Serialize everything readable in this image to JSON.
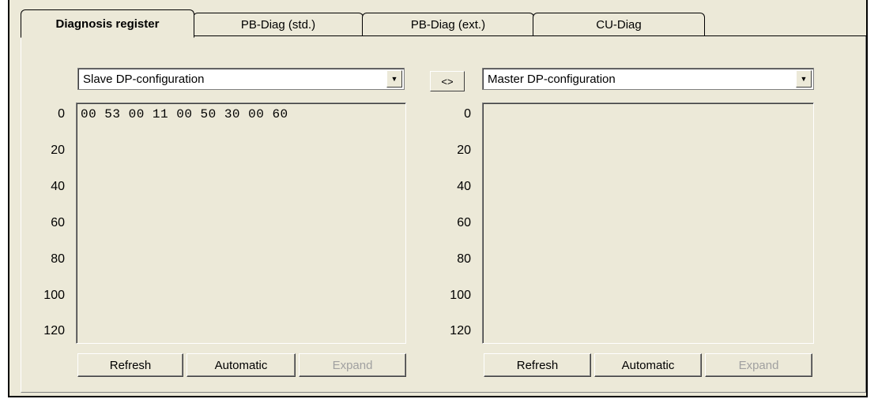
{
  "tabs": [
    {
      "label": "Diagnosis register",
      "active": true
    },
    {
      "label": "PB-Diag (std.)",
      "active": false
    },
    {
      "label": "PB-Diag (ext.)",
      "active": false
    },
    {
      "label": "CU-Diag",
      "active": false
    }
  ],
  "left": {
    "combo_value": "Slave DP-configuration",
    "row_labels": [
      "0",
      "20",
      "40",
      "60",
      "80",
      "100",
      "120"
    ],
    "hex_data": "00 53 00 11 00 50 30 00 60",
    "buttons": {
      "refresh": "Refresh",
      "automatic": "Automatic",
      "expand": "Expand"
    }
  },
  "swap_label": "<>",
  "right": {
    "combo_value": "Master DP-configuration",
    "row_labels": [
      "0",
      "20",
      "40",
      "60",
      "80",
      "100",
      "120"
    ],
    "hex_data": "",
    "buttons": {
      "refresh": "Refresh",
      "automatic": "Automatic",
      "expand": "Expand"
    }
  },
  "icons": {
    "dropdown": "chevron-down-icon"
  }
}
